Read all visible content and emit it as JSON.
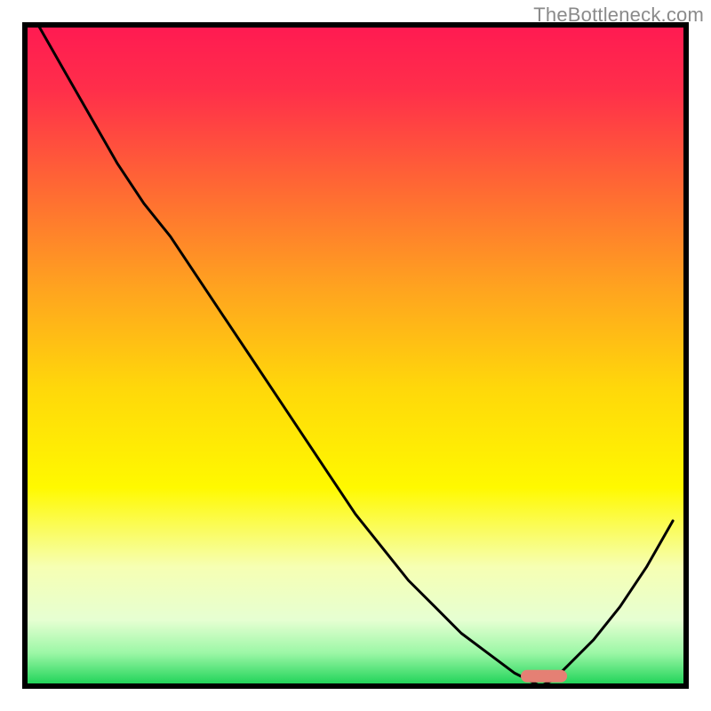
{
  "watermark": "TheBottleneck.com",
  "chart_data": {
    "type": "line",
    "title": "",
    "xlabel": "",
    "ylabel": "",
    "xlim": [
      0,
      100
    ],
    "ylim": [
      0,
      100
    ],
    "note": "Stylized bottleneck curve over a vertical heat-gradient background (red high → green low). The black curve descends from top-left to a minimum near x≈78 and rises again toward the right. A small salmon marker highlights the trough.",
    "series": [
      {
        "name": "curve",
        "x": [
          2,
          6,
          10,
          14,
          18,
          22,
          26,
          30,
          34,
          38,
          42,
          46,
          50,
          54,
          58,
          62,
          66,
          70,
          74,
          76,
          78,
          80,
          82,
          86,
          90,
          94,
          98
        ],
        "values": [
          100,
          93,
          86,
          79,
          73,
          68,
          62,
          56,
          50,
          44,
          38,
          32,
          26,
          21,
          16,
          12,
          8,
          5,
          2,
          1,
          0,
          1,
          3,
          7,
          12,
          18,
          25
        ]
      }
    ],
    "marker": {
      "name": "trough",
      "x_range": [
        75,
        82
      ],
      "y": 1.5,
      "color": "#e58074"
    },
    "background_gradient_stops": [
      {
        "offset": 0.0,
        "color": "#ff1a52"
      },
      {
        "offset": 0.1,
        "color": "#ff2f4a"
      },
      {
        "offset": 0.25,
        "color": "#ff6a33"
      },
      {
        "offset": 0.4,
        "color": "#ffa41f"
      },
      {
        "offset": 0.55,
        "color": "#ffd80a"
      },
      {
        "offset": 0.7,
        "color": "#fff900"
      },
      {
        "offset": 0.82,
        "color": "#f6ffb3"
      },
      {
        "offset": 0.9,
        "color": "#e6ffd2"
      },
      {
        "offset": 0.95,
        "color": "#9cf7a6"
      },
      {
        "offset": 1.0,
        "color": "#18d154"
      }
    ]
  }
}
